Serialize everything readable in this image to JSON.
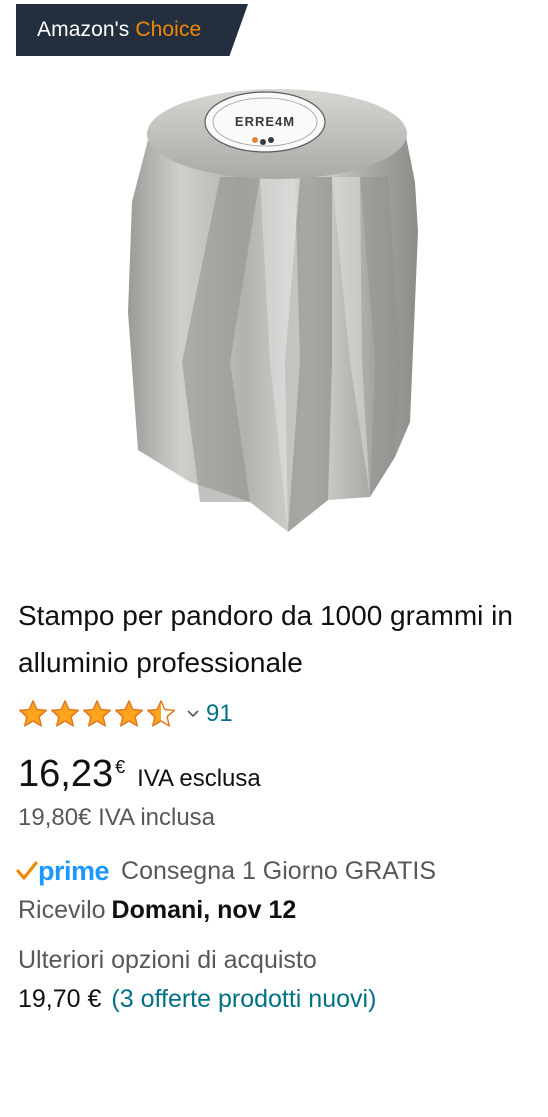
{
  "badge": {
    "prefix": "Amazon's",
    "highlight": "Choice",
    "highlight_color": "#f08804",
    "background": "#232f3e"
  },
  "product": {
    "image_icon": "pandoro-mold-image",
    "image_brand": "ERRE4M",
    "title": "Stampo per pandoro da 1000 grammi in alluminio professionale"
  },
  "rating": {
    "stars": 4.5,
    "stars_out_of": 5,
    "count": "91",
    "star_color": "#ffa41c"
  },
  "price": {
    "main": "16,23",
    "currency": "€",
    "note": "IVA esclusa",
    "inclusive": "19,80€ IVA inclusa"
  },
  "prime": {
    "word": "prime",
    "delivery": "Consegna 1 Giorno GRATIS",
    "check_color": "#f08804",
    "word_color": "#1a98ff"
  },
  "delivery": {
    "prefix": "Ricevilo",
    "date": "Domani, nov 12"
  },
  "other_offers": {
    "label": "Ulteriori opzioni di acquisto",
    "price": "19,70 €",
    "link": "(3 offerte prodotti nuovi)"
  }
}
